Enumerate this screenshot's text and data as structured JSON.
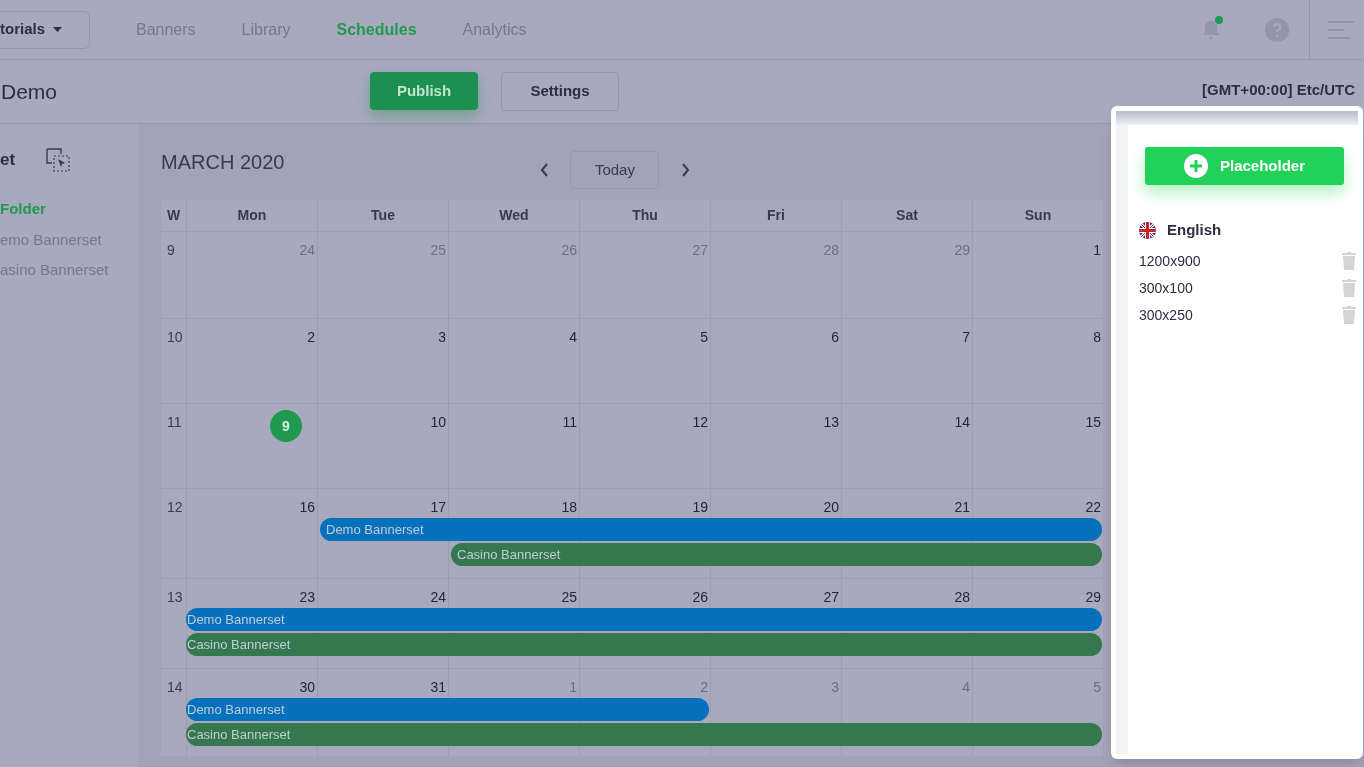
{
  "project_menu": {
    "label": "torials"
  },
  "nav": [
    {
      "label": "Banners",
      "selected": false
    },
    {
      "label": "Library",
      "selected": false
    },
    {
      "label": "Schedules",
      "selected": true
    },
    {
      "label": "Analytics",
      "selected": false
    }
  ],
  "notifications": {
    "unread": true
  },
  "page_title": "Demo",
  "actions": [
    {
      "label": "Publish",
      "kind": "primary"
    },
    {
      "label": "Settings",
      "kind": "secondary"
    }
  ],
  "timezone": "[GMT+00:00] Etc/UTC",
  "sidebar": {
    "heading": "et",
    "items": [
      {
        "label": "Folder",
        "selected": true
      },
      {
        "label": "emo Bannerset",
        "selected": false
      },
      {
        "label": "asino Bannerset",
        "selected": false
      }
    ]
  },
  "calendar": {
    "title": "MARCH 2020",
    "today_button": "Today",
    "columns": [
      "W",
      "Mon",
      "Tue",
      "Wed",
      "Thu",
      "Fri",
      "Sat",
      "Sun"
    ],
    "weeks": [
      {
        "week": "9",
        "days": [
          {
            "label": "24",
            "muted": true,
            "today": false
          },
          {
            "label": "25",
            "muted": true,
            "today": false
          },
          {
            "label": "26",
            "muted": true,
            "today": false
          },
          {
            "label": "27",
            "muted": true,
            "today": false
          },
          {
            "label": "28",
            "muted": true,
            "today": false
          },
          {
            "label": "29",
            "muted": true,
            "today": false
          },
          {
            "label": "1",
            "muted": false,
            "today": false
          }
        ]
      },
      {
        "week": "10",
        "days": [
          {
            "label": "2",
            "muted": false,
            "today": false
          },
          {
            "label": "3",
            "muted": false,
            "today": false
          },
          {
            "label": "4",
            "muted": false,
            "today": false
          },
          {
            "label": "5",
            "muted": false,
            "today": false
          },
          {
            "label": "6",
            "muted": false,
            "today": false
          },
          {
            "label": "7",
            "muted": false,
            "today": false
          },
          {
            "label": "8",
            "muted": false,
            "today": false
          }
        ]
      },
      {
        "week": "11",
        "days": [
          {
            "label": "9",
            "muted": false,
            "today": true
          },
          {
            "label": "10",
            "muted": false,
            "today": false
          },
          {
            "label": "11",
            "muted": false,
            "today": false
          },
          {
            "label": "12",
            "muted": false,
            "today": false
          },
          {
            "label": "13",
            "muted": false,
            "today": false
          },
          {
            "label": "14",
            "muted": false,
            "today": false
          },
          {
            "label": "15",
            "muted": false,
            "today": false
          }
        ]
      },
      {
        "week": "12",
        "days": [
          {
            "label": "16",
            "muted": false,
            "today": false
          },
          {
            "label": "17",
            "muted": false,
            "today": false,
            "events": [
              {
                "label": "Demo Bannerset",
                "color": "#0571bc",
                "kind": "until_sunday"
              }
            ]
          },
          {
            "label": "18",
            "muted": false,
            "today": false,
            "events": [
              {
                "label": "Casino Bannerset",
                "color": "#35784e",
                "kind": "until_sunday"
              }
            ]
          },
          {
            "label": "19",
            "muted": false,
            "today": false
          },
          {
            "label": "20",
            "muted": false,
            "today": false
          },
          {
            "label": "21",
            "muted": false,
            "today": false
          },
          {
            "label": "22",
            "muted": false,
            "today": false
          }
        ]
      },
      {
        "week": "13",
        "days": [
          {
            "label": "23",
            "muted": false,
            "today": false,
            "events": [
              {
                "label": "Demo Bannerset",
                "color": "#0571bc",
                "kind": "until_sunday"
              },
              {
                "label": "Casino Bannerset",
                "color": "#35784e",
                "kind": "until_sunday"
              }
            ]
          },
          {
            "label": "24",
            "muted": false,
            "today": false
          },
          {
            "label": "25",
            "muted": false,
            "today": false
          },
          {
            "label": "26",
            "muted": false,
            "today": false
          },
          {
            "label": "27",
            "muted": false,
            "today": false
          },
          {
            "label": "28",
            "muted": false,
            "today": false
          },
          {
            "label": "29",
            "muted": false,
            "today": false
          }
        ]
      },
      {
        "week": "14",
        "days": [
          {
            "label": "30",
            "muted": false,
            "today": false,
            "events": [
              {
                "label": "Demo Bannerset",
                "color": "#0571bc",
                "kind": "until_thursday"
              },
              {
                "label": "Casino Bannerset",
                "color": "#35784e",
                "kind": "until_sunday"
              }
            ]
          },
          {
            "label": "31",
            "muted": false,
            "today": false
          },
          {
            "label": "1",
            "muted": true,
            "today": false
          },
          {
            "label": "2",
            "muted": true,
            "today": false
          },
          {
            "label": "3",
            "muted": true,
            "today": false
          },
          {
            "label": "4",
            "muted": true,
            "today": false
          },
          {
            "label": "5",
            "muted": true,
            "today": false
          }
        ]
      }
    ]
  },
  "panel": {
    "add_button": "Placeholder",
    "language": "English",
    "sizes": [
      "1200x900",
      "300x100",
      "300x250"
    ]
  }
}
